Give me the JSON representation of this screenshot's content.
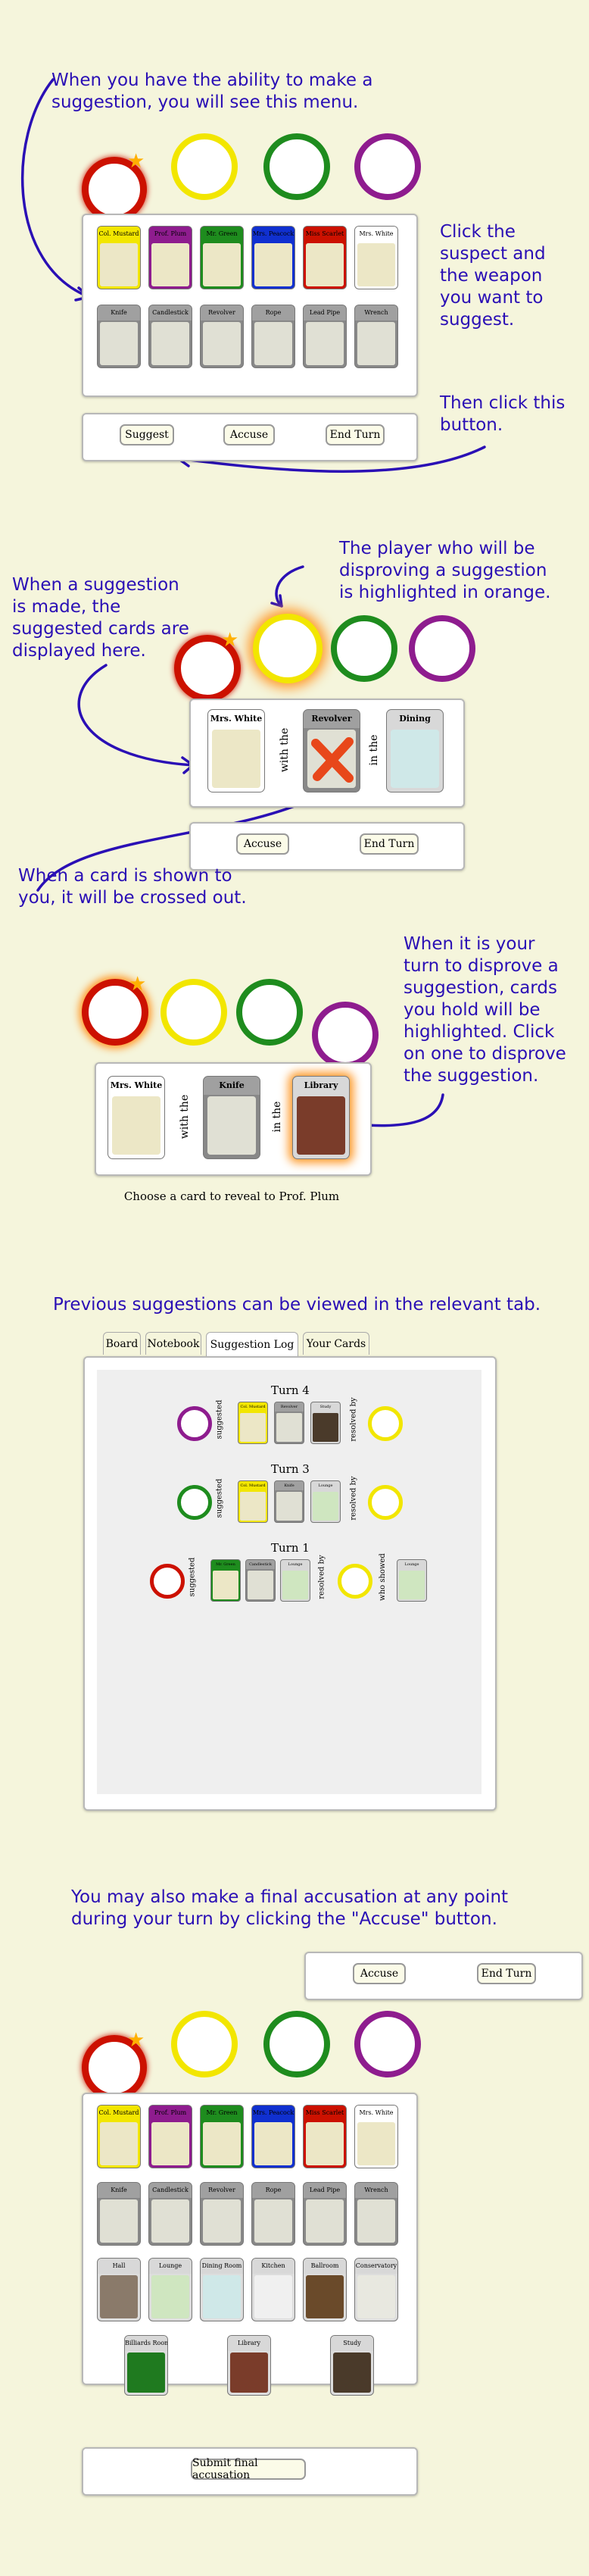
{
  "notes": {
    "n1": "When you have the ability to make a\nsuggestion, you will see this menu.",
    "n2": "Click the\nsuspect and\nthe weapon\nyou want to\nsuggest.",
    "n3": "Then click this\nbutton.",
    "n4": "The player who will be\ndisproving a suggestion\nis highlighted in orange.",
    "n5": "When a suggestion\nis made, the\nsuggested cards are\ndisplayed here.",
    "n6": "When a card is shown to\nyou, it will be crossed out.",
    "n7": "When it is your\nturn to disprove a\nsuggestion, cards\nyou hold will be\nhighlighted. Click\non one to disprove\nthe suggestion.",
    "n8": "Previous suggestions can be viewed in the relevant tab.",
    "n9": "You may also make a final accusation at any point\nduring your turn by clicking the \"Accuse\" button."
  },
  "colors": {
    "accent": "#2a0fb5",
    "scarlet": "#cc1100",
    "mustard": "#f2e600",
    "green": "#1e8c1e",
    "plum": "#8e1c8e",
    "peacock": "#1030d0",
    "highlight": "#ff9a2a"
  },
  "suspects": [
    "Col. Mustard",
    "Prof. Plum",
    "Mr. Green",
    "Mrs. Peacock",
    "Miss Scarlet",
    "Mrs. White"
  ],
  "weapons": [
    "Knife",
    "Candlestick",
    "Revolver",
    "Rope",
    "Lead Pipe",
    "Wrench"
  ],
  "rooms": [
    "Hall",
    "Lounge",
    "Dining Room",
    "Kitchen",
    "Ballroom",
    "Conservatory",
    "Billiards Room",
    "Library",
    "Study"
  ],
  "buttons": {
    "suggest": "Suggest",
    "accuse": "Accuse",
    "end_turn": "End Turn",
    "submit_final": "Submit final accusation"
  },
  "connectors": {
    "with_the": "with the",
    "in_the": "in the"
  },
  "suggestion2": {
    "suspect": "Mrs. White",
    "weapon": "Revolver",
    "room": "Dining Room"
  },
  "suggestion3": {
    "suspect": "Mrs. White",
    "weapon": "Knife",
    "room": "Library",
    "prompt": "Choose a card to reveal to Prof. Plum"
  },
  "tabs": [
    "Board",
    "Notebook",
    "Suggestion Log",
    "Your Cards"
  ],
  "log": {
    "turn4": "Turn 4",
    "turn3": "Turn 3",
    "turn1": "Turn 1",
    "suggested": "suggested",
    "resolved_by": "resolved by",
    "who_showed": "who showed"
  }
}
